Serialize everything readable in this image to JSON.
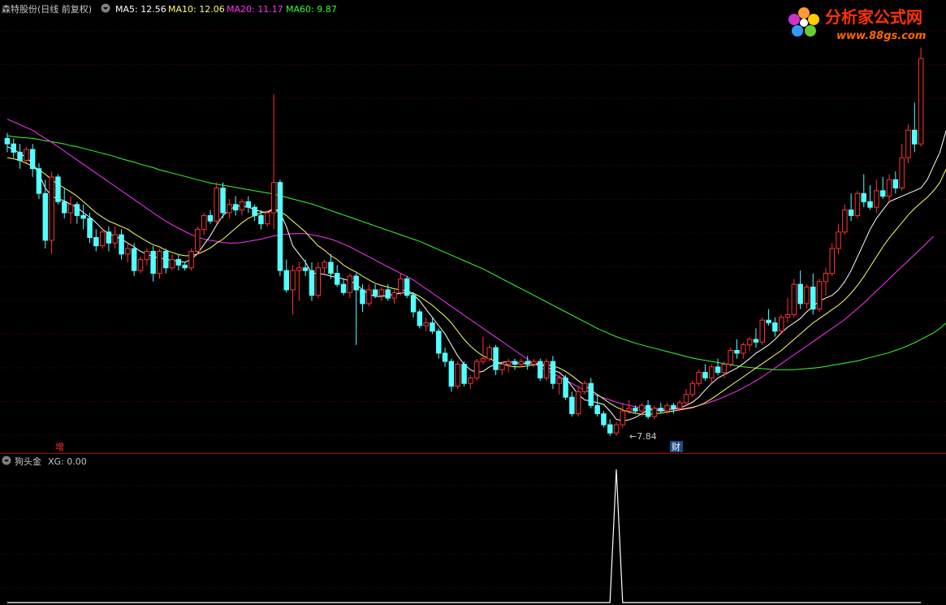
{
  "header": {
    "stock_label": "森特股份(日线 前复权)",
    "ma_labels": [
      {
        "text": "MA5: 12.56",
        "color": "#ffffff"
      },
      {
        "text": "MA10: 12.06",
        "color": "#ffff66"
      },
      {
        "text": "MA20: 11.17",
        "color": "#ff33ff"
      },
      {
        "text": "MA60: 9.87",
        "color": "#33ff33"
      }
    ]
  },
  "indicator": {
    "name": "狗头金",
    "xg_label": "XG: 0.00"
  },
  "markers": {
    "zeng": "增",
    "cai": "财",
    "low_label": "←7.84"
  },
  "watermark": {
    "line1": "分析家公式网",
    "line2": "www.88gs.com"
  },
  "colors": {
    "up": "#ff3232",
    "down": "#54ffff",
    "ma5": "#ffffff",
    "ma10": "#ffff66",
    "ma20": "#ff33ff",
    "ma60": "#33ff33",
    "grid": "#5a0000",
    "separator": "#b00000"
  },
  "chart_data": {
    "type": "candlestick",
    "y_range": [
      7.5,
      14.8
    ],
    "indicator_range": [
      0,
      1
    ],
    "signal_bar_index": 96,
    "candles": [
      [
        12.95,
        13.05,
        12.7,
        12.85
      ],
      [
        12.85,
        12.95,
        12.6,
        12.7
      ],
      [
        12.7,
        12.85,
        12.4,
        12.55
      ],
      [
        12.55,
        12.8,
        12.5,
        12.75
      ],
      [
        12.75,
        12.85,
        12.25,
        12.4
      ],
      [
        12.4,
        12.5,
        11.85,
        11.95
      ],
      [
        11.95,
        12.2,
        10.95,
        11.1
      ],
      [
        11.1,
        12.35,
        10.85,
        12.25
      ],
      [
        12.25,
        12.3,
        11.75,
        11.8
      ],
      [
        11.8,
        12.05,
        11.5,
        11.6
      ],
      [
        11.6,
        11.9,
        11.4,
        11.75
      ],
      [
        11.75,
        11.8,
        11.4,
        11.55
      ],
      [
        11.55,
        11.75,
        11.3,
        11.5
      ],
      [
        11.5,
        11.6,
        11.05,
        11.15
      ],
      [
        11.15,
        11.3,
        10.9,
        11.0
      ],
      [
        11.0,
        11.3,
        10.95,
        11.25
      ],
      [
        11.25,
        11.35,
        10.9,
        11.05
      ],
      [
        11.05,
        11.35,
        10.95,
        11.2
      ],
      [
        11.2,
        11.3,
        10.75,
        10.85
      ],
      [
        10.85,
        11.05,
        10.7,
        10.95
      ],
      [
        10.95,
        11.05,
        10.45,
        10.55
      ],
      [
        10.55,
        10.8,
        10.5,
        10.75
      ],
      [
        10.75,
        10.95,
        10.65,
        10.9
      ],
      [
        10.9,
        11.0,
        10.35,
        10.5
      ],
      [
        10.5,
        10.95,
        10.4,
        10.9
      ],
      [
        10.9,
        10.95,
        10.5,
        10.6
      ],
      [
        10.6,
        10.85,
        10.55,
        10.75
      ],
      [
        10.75,
        10.85,
        10.55,
        10.65
      ],
      [
        10.65,
        10.7,
        10.55,
        10.6
      ],
      [
        10.6,
        10.95,
        10.55,
        10.9
      ],
      [
        10.9,
        11.35,
        10.85,
        11.3
      ],
      [
        11.3,
        11.6,
        11.2,
        11.55
      ],
      [
        11.55,
        11.65,
        11.4,
        11.45
      ],
      [
        11.45,
        12.15,
        11.4,
        12.05
      ],
      [
        12.05,
        12.15,
        11.5,
        11.6
      ],
      [
        11.6,
        11.85,
        11.5,
        11.75
      ],
      [
        11.75,
        11.9,
        11.55,
        11.65
      ],
      [
        11.65,
        11.85,
        11.55,
        11.8
      ],
      [
        11.8,
        11.9,
        11.6,
        11.7
      ],
      [
        11.7,
        11.75,
        11.45,
        11.55
      ],
      [
        11.55,
        11.65,
        11.3,
        11.4
      ],
      [
        11.4,
        11.65,
        11.35,
        11.6
      ],
      [
        11.6,
        13.75,
        11.3,
        12.15
      ],
      [
        12.15,
        12.2,
        10.45,
        10.55
      ],
      [
        10.55,
        10.75,
        10.15,
        10.2
      ],
      [
        10.2,
        10.65,
        9.75,
        10.55
      ],
      [
        10.55,
        10.7,
        10.0,
        10.6
      ],
      [
        10.6,
        10.75,
        10.45,
        10.55
      ],
      [
        10.55,
        10.7,
        10.0,
        10.1
      ],
      [
        10.1,
        10.7,
        10.05,
        10.6
      ],
      [
        10.6,
        10.75,
        10.5,
        10.7
      ],
      [
        10.7,
        10.85,
        10.4,
        10.5
      ],
      [
        10.5,
        10.65,
        10.25,
        10.3
      ],
      [
        10.3,
        10.4,
        10.1,
        10.15
      ],
      [
        10.15,
        10.5,
        10.05,
        10.45
      ],
      [
        10.45,
        10.5,
        9.2,
        10.2
      ],
      [
        10.2,
        10.3,
        9.8,
        9.95
      ],
      [
        9.95,
        10.3,
        9.9,
        10.2
      ],
      [
        10.2,
        10.3,
        10.05,
        10.1
      ],
      [
        10.1,
        10.25,
        10.0,
        10.2
      ],
      [
        10.2,
        10.3,
        10.0,
        10.05
      ],
      [
        10.05,
        10.2,
        9.95,
        10.15
      ],
      [
        10.15,
        10.5,
        10.1,
        10.4
      ],
      [
        10.4,
        10.45,
        10.05,
        10.1
      ],
      [
        10.1,
        10.15,
        9.7,
        9.8
      ],
      [
        9.8,
        9.85,
        9.5,
        9.55
      ],
      [
        9.55,
        9.7,
        9.45,
        9.6
      ],
      [
        9.6,
        9.7,
        9.4,
        9.45
      ],
      [
        9.45,
        9.5,
        8.95,
        9.05
      ],
      [
        9.05,
        9.15,
        8.8,
        8.9
      ],
      [
        8.9,
        8.95,
        8.35,
        8.45
      ],
      [
        8.45,
        8.9,
        8.4,
        8.85
      ],
      [
        8.85,
        8.9,
        8.45,
        8.5
      ],
      [
        8.5,
        8.65,
        8.4,
        8.6
      ],
      [
        8.6,
        8.95,
        8.55,
        8.9
      ],
      [
        8.9,
        9.35,
        8.85,
        8.95
      ],
      [
        8.95,
        9.2,
        8.9,
        9.15
      ],
      [
        9.15,
        9.2,
        8.65,
        8.75
      ],
      [
        8.75,
        8.9,
        8.65,
        8.85
      ],
      [
        8.85,
        8.95,
        8.7,
        8.9
      ],
      [
        8.9,
        8.95,
        8.75,
        8.85
      ],
      [
        8.85,
        8.95,
        8.8,
        8.9
      ],
      [
        8.9,
        9.0,
        8.75,
        8.85
      ],
      [
        8.85,
        8.95,
        8.8,
        8.9
      ],
      [
        8.9,
        8.95,
        8.55,
        8.6
      ],
      [
        8.6,
        8.95,
        8.55,
        8.9
      ],
      [
        8.9,
        9.0,
        8.4,
        8.5
      ],
      [
        8.5,
        8.65,
        8.3,
        8.6
      ],
      [
        8.6,
        8.65,
        8.2,
        8.25
      ],
      [
        8.25,
        8.35,
        7.9,
        7.95
      ],
      [
        7.95,
        8.45,
        7.9,
        8.35
      ],
      [
        8.35,
        8.55,
        8.3,
        8.5
      ],
      [
        8.5,
        8.6,
        8.05,
        8.1
      ],
      [
        8.1,
        8.3,
        7.9,
        7.95
      ],
      [
        7.95,
        8.0,
        7.7,
        7.75
      ],
      [
        7.75,
        7.85,
        7.55,
        7.6
      ],
      [
        7.6,
        7.8,
        7.55,
        7.75
      ],
      [
        7.75,
        8.15,
        7.7,
        8.0
      ],
      [
        8.0,
        8.2,
        7.95,
        8.05
      ],
      [
        8.05,
        8.1,
        7.95,
        8.0
      ],
      [
        8.0,
        8.15,
        7.9,
        8.1
      ],
      [
        8.1,
        8.2,
        7.85,
        7.9
      ],
      [
        7.9,
        8.1,
        7.85,
        8.05
      ],
      [
        8.05,
        8.15,
        7.95,
        8.0
      ],
      [
        8.0,
        8.15,
        7.95,
        8.1
      ],
      [
        8.1,
        8.15,
        7.95,
        8.05
      ],
      [
        8.05,
        8.2,
        8.0,
        8.15
      ],
      [
        8.15,
        8.4,
        8.1,
        8.3
      ],
      [
        8.3,
        8.55,
        8.25,
        8.5
      ],
      [
        8.5,
        8.75,
        8.45,
        8.7
      ],
      [
        8.7,
        8.85,
        8.55,
        8.6
      ],
      [
        8.6,
        8.85,
        8.5,
        8.8
      ],
      [
        8.8,
        8.95,
        8.65,
        8.7
      ],
      [
        8.7,
        8.9,
        8.6,
        8.85
      ],
      [
        8.85,
        9.15,
        8.8,
        9.1
      ],
      [
        9.1,
        9.3,
        8.95,
        9.05
      ],
      [
        9.05,
        9.25,
        8.95,
        9.2
      ],
      [
        9.2,
        9.35,
        9.1,
        9.3
      ],
      [
        9.3,
        9.5,
        9.15,
        9.25
      ],
      [
        9.25,
        9.7,
        9.2,
        9.65
      ],
      [
        9.65,
        9.85,
        9.55,
        9.6
      ],
      [
        9.6,
        9.7,
        9.35,
        9.45
      ],
      [
        9.45,
        9.75,
        9.4,
        9.7
      ],
      [
        9.7,
        10.05,
        9.6,
        9.75
      ],
      [
        9.75,
        10.4,
        9.7,
        10.3
      ],
      [
        10.3,
        10.55,
        9.85,
        9.95
      ],
      [
        9.95,
        10.3,
        9.85,
        10.25
      ],
      [
        10.25,
        10.5,
        9.75,
        9.85
      ],
      [
        9.85,
        10.4,
        9.8,
        10.35
      ],
      [
        10.35,
        10.6,
        10.1,
        10.5
      ],
      [
        10.5,
        11.05,
        10.45,
        10.95
      ],
      [
        10.95,
        11.4,
        10.85,
        11.25
      ],
      [
        11.25,
        11.75,
        11.2,
        11.65
      ],
      [
        11.65,
        11.95,
        11.45,
        11.55
      ],
      [
        11.55,
        12.0,
        11.5,
        11.95
      ],
      [
        11.95,
        12.3,
        11.7,
        11.8
      ],
      [
        11.8,
        12.1,
        11.65,
        11.7
      ],
      [
        11.7,
        12.2,
        11.6,
        12.0
      ],
      [
        12.0,
        12.25,
        11.85,
        11.9
      ],
      [
        11.9,
        12.3,
        11.8,
        12.2
      ],
      [
        12.2,
        12.35,
        11.95,
        12.05
      ],
      [
        12.05,
        12.85,
        12.0,
        12.6
      ],
      [
        12.6,
        13.2,
        12.5,
        13.1
      ],
      [
        13.1,
        13.6,
        12.7,
        12.85
      ],
      [
        12.85,
        14.6,
        12.8,
        14.4
      ]
    ],
    "ma5": [
      12.8,
      12.75,
      12.68,
      12.6,
      12.5,
      12.3,
      12.05,
      11.9,
      11.85,
      11.82,
      11.75,
      11.7,
      11.6,
      11.52,
      11.42,
      11.3,
      11.22,
      11.18,
      11.12,
      11.05,
      10.98,
      10.9,
      10.85,
      10.8,
      10.78,
      10.75,
      10.74,
      10.72,
      10.7,
      10.75,
      10.86,
      11.02,
      11.18,
      11.38,
      11.55,
      11.65,
      11.72,
      11.72,
      11.7,
      11.66,
      11.62,
      11.6,
      11.7,
      11.6,
      11.35,
      11.0,
      10.85,
      10.7,
      10.5,
      10.5,
      10.48,
      10.45,
      10.42,
      10.4,
      10.36,
      10.3,
      10.2,
      10.12,
      10.08,
      10.08,
      10.1,
      10.12,
      10.14,
      10.15,
      10.12,
      10.0,
      9.85,
      9.7,
      9.55,
      9.4,
      9.2,
      9.0,
      8.85,
      8.75,
      8.7,
      8.72,
      8.8,
      8.85,
      8.88,
      8.9,
      8.88,
      8.86,
      8.87,
      8.88,
      8.84,
      8.8,
      8.74,
      8.7,
      8.6,
      8.45,
      8.3,
      8.2,
      8.18,
      8.15,
      8.12,
      8.0,
      7.85,
      7.82,
      7.84,
      7.88,
      7.95,
      8.02,
      8.03,
      8.0,
      8.02,
      8.04,
      8.06,
      8.1,
      8.16,
      8.25,
      8.38,
      8.5,
      8.6,
      8.66,
      8.72,
      8.78,
      8.86,
      8.95,
      9.05,
      9.12,
      9.2,
      9.3,
      9.42,
      9.52,
      9.6,
      9.68,
      9.8,
      9.9,
      10.0,
      10.05,
      10.1,
      10.2,
      10.35,
      10.55,
      10.8,
      11.05,
      11.3,
      11.5,
      11.65,
      11.8,
      11.85,
      11.9,
      11.95,
      12.0,
      12.05,
      12.2,
      12.45,
      12.7,
      13.1
    ],
    "ma10": [
      12.6,
      12.58,
      12.55,
      12.5,
      12.45,
      12.38,
      12.3,
      12.2,
      12.12,
      12.05,
      11.98,
      11.9,
      11.8,
      11.7,
      11.6,
      11.52,
      11.45,
      11.4,
      11.35,
      11.3,
      11.22,
      11.15,
      11.08,
      11.02,
      10.98,
      10.92,
      10.88,
      10.84,
      10.82,
      10.82,
      10.85,
      10.9,
      10.96,
      11.05,
      11.12,
      11.22,
      11.32,
      11.42,
      11.5,
      11.55,
      11.6,
      11.62,
      11.64,
      11.62,
      11.55,
      11.45,
      11.35,
      11.25,
      11.12,
      11.0,
      10.92,
      10.82,
      10.75,
      10.65,
      10.58,
      10.52,
      10.45,
      10.38,
      10.32,
      10.28,
      10.25,
      10.22,
      10.2,
      10.18,
      10.14,
      10.08,
      10.0,
      9.92,
      9.82,
      9.72,
      9.6,
      9.45,
      9.3,
      9.18,
      9.08,
      9.0,
      8.95,
      8.9,
      8.86,
      8.82,
      8.8,
      8.8,
      8.82,
      8.84,
      8.85,
      8.84,
      8.82,
      8.78,
      8.72,
      8.64,
      8.55,
      8.46,
      8.38,
      8.3,
      8.22,
      8.14,
      8.07,
      8.02,
      7.98,
      7.96,
      7.94,
      7.94,
      7.95,
      7.96,
      7.98,
      8.0,
      8.02,
      8.04,
      8.06,
      8.1,
      8.15,
      8.22,
      8.3,
      8.38,
      8.46,
      8.54,
      8.62,
      8.7,
      8.78,
      8.86,
      8.94,
      9.02,
      9.1,
      9.2,
      9.3,
      9.4,
      9.5,
      9.6,
      9.68,
      9.76,
      9.84,
      9.92,
      10.02,
      10.14,
      10.28,
      10.44,
      10.62,
      10.8,
      10.98,
      11.14,
      11.28,
      11.42,
      11.56,
      11.68,
      11.78,
      11.88,
      12.0,
      12.15,
      12.4
    ],
    "ma20": [
      13.3,
      13.25,
      13.2,
      13.15,
      13.1,
      13.02,
      12.95,
      12.88,
      12.8,
      12.72,
      12.64,
      12.56,
      12.48,
      12.4,
      12.32,
      12.24,
      12.16,
      12.08,
      12.0,
      11.92,
      11.84,
      11.76,
      11.68,
      11.6,
      11.52,
      11.45,
      11.38,
      11.32,
      11.26,
      11.2,
      11.16,
      11.12,
      11.1,
      11.08,
      11.06,
      11.05,
      11.05,
      11.06,
      11.08,
      11.1,
      11.12,
      11.15,
      11.18,
      11.2,
      11.21,
      11.22,
      11.22,
      11.22,
      11.2,
      11.18,
      11.15,
      11.12,
      11.08,
      11.03,
      10.98,
      10.92,
      10.86,
      10.8,
      10.74,
      10.68,
      10.62,
      10.56,
      10.5,
      10.44,
      10.38,
      10.3,
      10.22,
      10.14,
      10.06,
      9.98,
      9.9,
      9.82,
      9.74,
      9.66,
      9.58,
      9.5,
      9.42,
      9.34,
      9.26,
      9.18,
      9.1,
      9.02,
      8.94,
      8.86,
      8.8,
      8.74,
      8.68,
      8.62,
      8.56,
      8.5,
      8.44,
      8.38,
      8.33,
      8.28,
      8.24,
      8.2,
      8.16,
      8.13,
      8.1,
      8.08,
      8.06,
      8.05,
      8.04,
      8.03,
      8.03,
      8.03,
      8.04,
      8.05,
      8.07,
      8.1,
      8.13,
      8.17,
      8.21,
      8.26,
      8.31,
      8.36,
      8.42,
      8.48,
      8.55,
      8.62,
      8.7,
      8.78,
      8.86,
      8.94,
      9.02,
      9.1,
      9.18,
      9.26,
      9.34,
      9.42,
      9.5,
      9.58,
      9.66,
      9.76,
      9.86,
      9.96,
      10.07,
      10.18,
      10.29,
      10.4,
      10.51,
      10.62,
      10.73,
      10.84,
      10.95,
      11.06,
      11.17
    ],
    "ma60": [
      13.0,
      12.98,
      12.97,
      12.96,
      12.95,
      12.93,
      12.91,
      12.89,
      12.87,
      12.85,
      12.82,
      12.8,
      12.77,
      12.74,
      12.71,
      12.68,
      12.65,
      12.62,
      12.58,
      12.55,
      12.52,
      12.48,
      12.45,
      12.42,
      12.38,
      12.35,
      12.32,
      12.29,
      12.26,
      12.23,
      12.2,
      12.17,
      12.14,
      12.12,
      12.1,
      12.08,
      12.06,
      12.04,
      12.02,
      12.0,
      11.98,
      11.96,
      11.94,
      11.91,
      11.88,
      11.85,
      11.82,
      11.79,
      11.76,
      11.72,
      11.68,
      11.64,
      11.6,
      11.56,
      11.52,
      11.48,
      11.44,
      11.4,
      11.36,
      11.32,
      11.28,
      11.24,
      11.2,
      11.16,
      11.12,
      11.08,
      11.03,
      10.98,
      10.93,
      10.88,
      10.83,
      10.78,
      10.73,
      10.68,
      10.63,
      10.58,
      10.52,
      10.46,
      10.4,
      10.34,
      10.28,
      10.22,
      10.16,
      10.1,
      10.04,
      9.98,
      9.92,
      9.86,
      9.8,
      9.74,
      9.68,
      9.62,
      9.56,
      9.5,
      9.45,
      9.4,
      9.35,
      9.31,
      9.27,
      9.23,
      9.2,
      9.17,
      9.14,
      9.11,
      9.08,
      9.05,
      9.02,
      8.99,
      8.96,
      8.94,
      8.92,
      8.9,
      8.88,
      8.86,
      8.84,
      8.82,
      8.8,
      8.79,
      8.78,
      8.77,
      8.76,
      8.75,
      8.75,
      8.75,
      8.75,
      8.76,
      8.77,
      8.78,
      8.79,
      8.81,
      8.83,
      8.85,
      8.87,
      8.89,
      8.91,
      8.94,
      8.97,
      9.0,
      9.03,
      9.06,
      9.1,
      9.14,
      9.19,
      9.24,
      9.3,
      9.36,
      9.42,
      9.5,
      9.6
    ]
  }
}
